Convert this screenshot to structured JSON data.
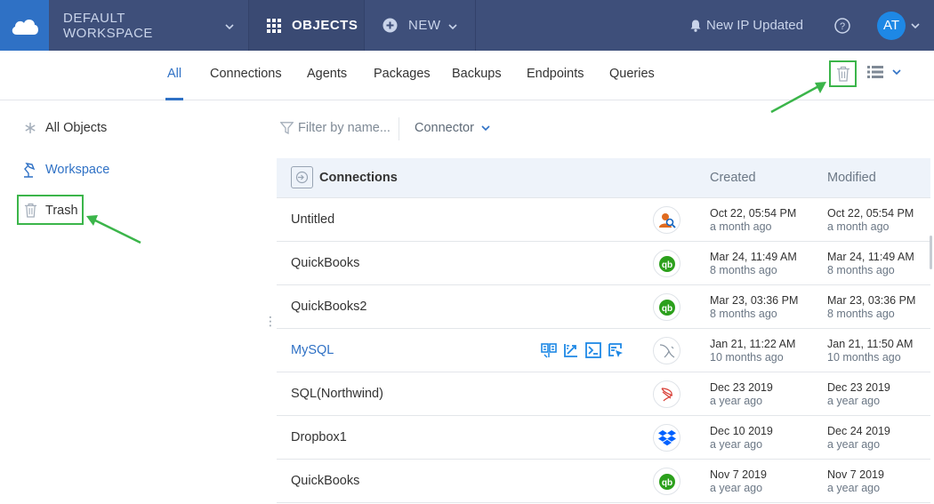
{
  "topbar": {
    "workspace": "DEFAULT WORKSPACE",
    "objects": "OBJECTS",
    "new": "NEW",
    "notification": "New IP Updated",
    "avatar": "AT"
  },
  "tabs": [
    "All",
    "Connections",
    "Agents",
    "Packages",
    "Backups",
    "Endpoints",
    "Queries"
  ],
  "sidebar": {
    "all_objects": "All Objects",
    "workspace": "Workspace",
    "trash": "Trash"
  },
  "filter": {
    "placeholder": "Filter by name...",
    "connector": "Connector"
  },
  "table": {
    "title": "Connections",
    "col_created": "Created",
    "col_modified": "Modified",
    "rows": [
      {
        "name": "Untitled",
        "icon": "user-search-icon",
        "created": "Oct 22, 05:54 PM",
        "created_ago": "a month ago",
        "modified": "Oct 22, 05:54 PM",
        "modified_ago": "a month ago"
      },
      {
        "name": "QuickBooks",
        "icon": "quickbooks-icon",
        "created": "Mar 24, 11:49 AM",
        "created_ago": "8 months ago",
        "modified": "Mar 24, 11:49 AM",
        "modified_ago": "8 months ago"
      },
      {
        "name": "QuickBooks2",
        "icon": "quickbooks-icon",
        "created": "Mar 23, 03:36 PM",
        "created_ago": "8 months ago",
        "modified": "Mar 23, 03:36 PM",
        "modified_ago": "8 months ago"
      },
      {
        "name": "MySQL",
        "icon": "mysql-icon",
        "created": "Jan 21, 11:22 AM",
        "created_ago": "10 months ago",
        "modified": "Jan 21, 11:50 AM",
        "modified_ago": "10 months ago"
      },
      {
        "name": "SQL(Northwind)",
        "icon": "sqlserver-icon",
        "created": "Dec 23 2019",
        "created_ago": "a year ago",
        "modified": "Dec 23 2019",
        "modified_ago": "a year ago"
      },
      {
        "name": "Dropbox1",
        "icon": "dropbox-icon",
        "created": "Dec 10 2019",
        "created_ago": "a year ago",
        "modified": "Dec 24 2019",
        "modified_ago": "a year ago"
      },
      {
        "name": "QuickBooks",
        "icon": "quickbooks-icon",
        "created": "Nov 7 2019",
        "created_ago": "a year ago",
        "modified": "Nov 7 2019",
        "modified_ago": "a year ago"
      }
    ]
  },
  "colors": {
    "topbar": "#3e4f7a",
    "accent": "#2f71c5",
    "highlight": "#3bb54a",
    "quickbooks": "#2ca01c"
  }
}
